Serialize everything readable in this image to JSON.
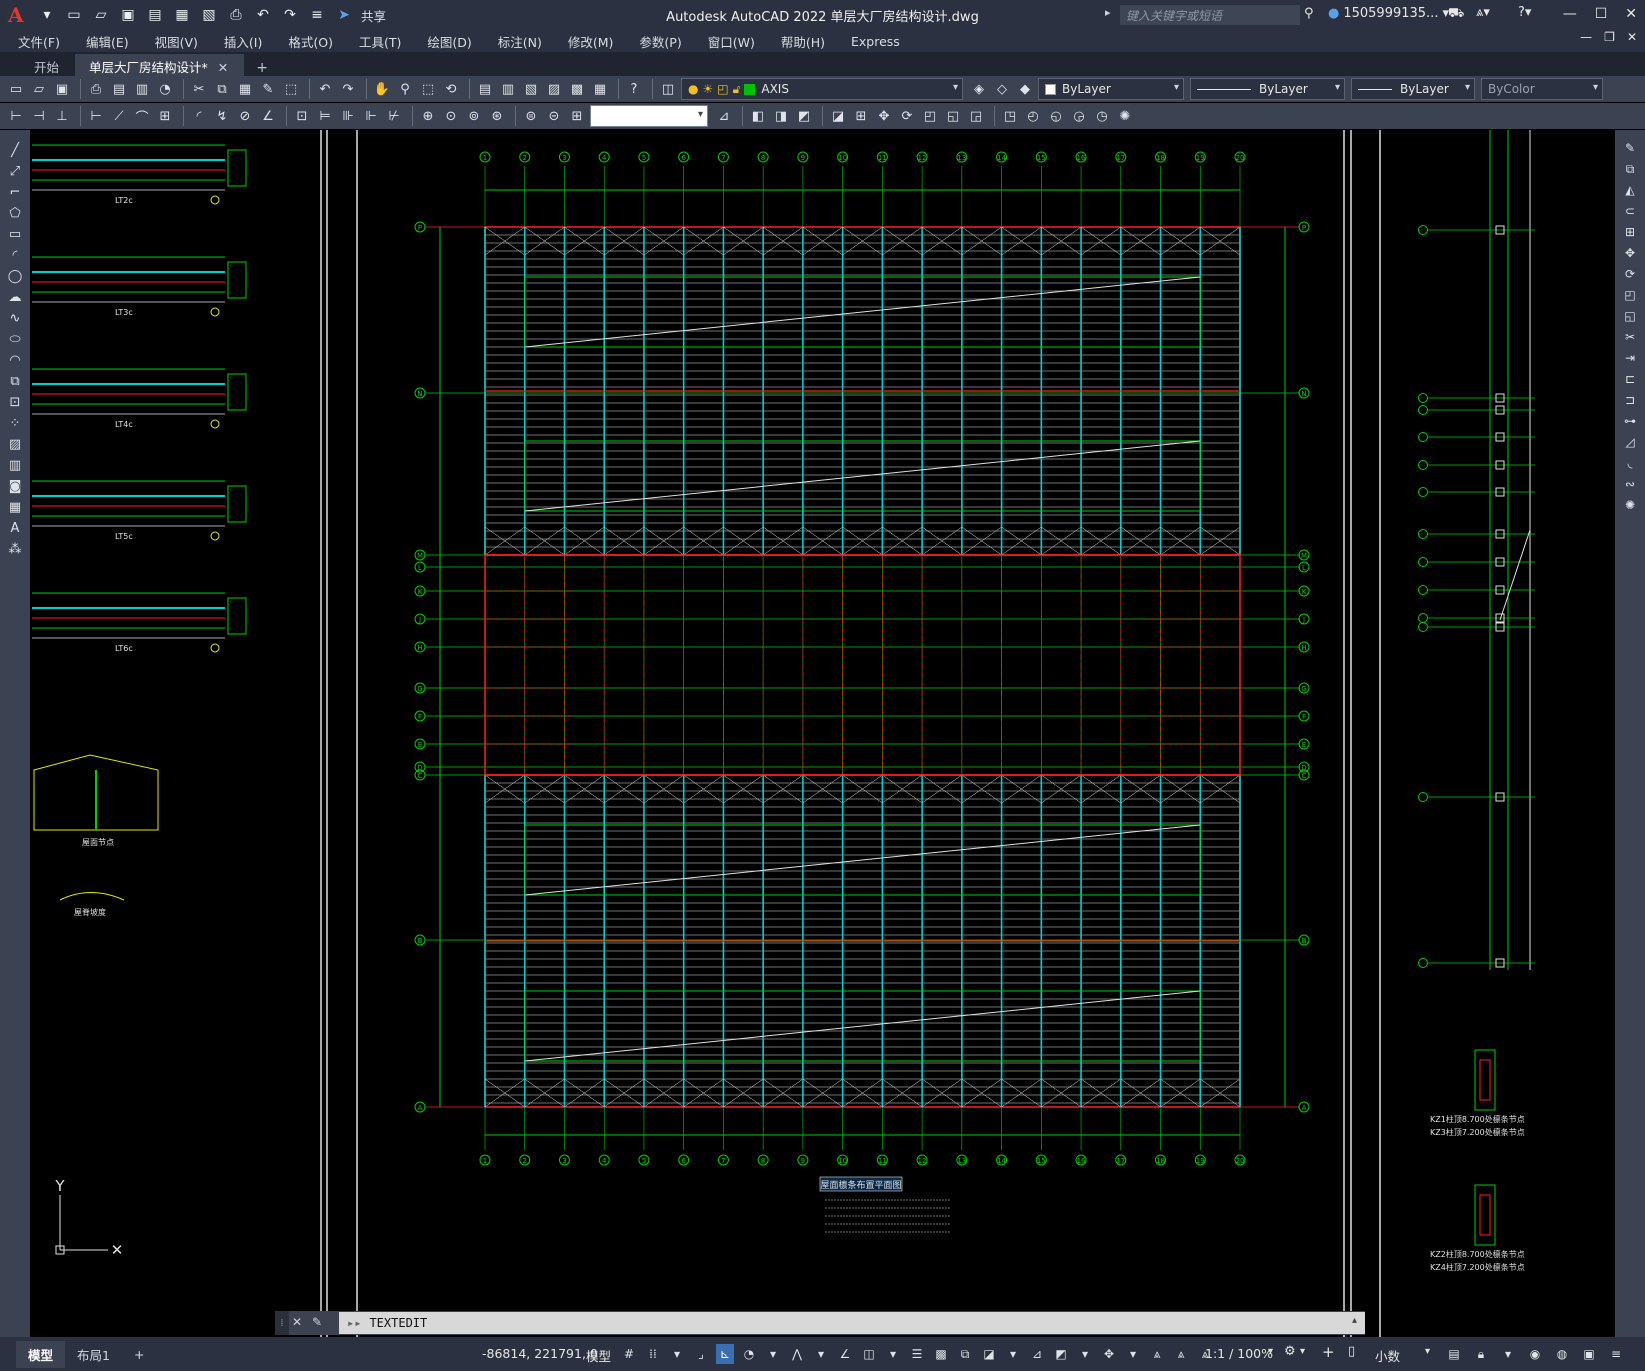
{
  "app": {
    "title": "Autodesk AutoCAD 2022    单层大厂房结构设计.dwg",
    "share_label": "共享",
    "search_placeholder": "键入关键字或短语",
    "user": "1505999135...",
    "accent": "#e8352b"
  },
  "menu": [
    "文件(F)",
    "编辑(E)",
    "视图(V)",
    "插入(I)",
    "格式(O)",
    "工具(T)",
    "绘图(D)",
    "标注(N)",
    "修改(M)",
    "参数(P)",
    "窗口(W)",
    "帮助(H)",
    "Express"
  ],
  "file_tabs": {
    "start": "开始",
    "active": "单层大厂房结构设计*"
  },
  "layer": {
    "name": "AXIS",
    "color_swatch": "#00c000"
  },
  "properties": {
    "color": "ByLayer",
    "linetype": "ByLayer",
    "lineweight": "ByLayer",
    "plotstyle": "ByColor"
  },
  "command_line": {
    "text": "TEXTEDIT"
  },
  "layout_tabs": [
    "模型",
    "布局1"
  ],
  "status": {
    "coordinates": "-86814, 221791, 0",
    "space": "模型",
    "scale": "1:1 / 100%",
    "units": "小数"
  },
  "drawing": {
    "left_details": [
      "LT2c",
      "LT3c",
      "LT4c",
      "LT5c",
      "LT6c"
    ],
    "node_labels": [
      "屋面节点",
      "屋脊坡度"
    ],
    "grid_cols": [
      "1",
      "2",
      "3",
      "4",
      "5",
      "6",
      "7",
      "8",
      "9",
      "10",
      "11",
      "12",
      "13",
      "14",
      "15",
      "16",
      "17",
      "18",
      "19",
      "20"
    ],
    "grid_rows": [
      "P",
      "N",
      "M",
      "L",
      "K",
      "J",
      "H",
      "G",
      "F",
      "E",
      "D",
      "C",
      "B",
      "A"
    ],
    "plan_title": "屋面檩条布置平面图",
    "column_details": [
      "KZ1柱顶8.700处檩条节点",
      "KZ3柱顶7.200处檩条节点",
      "KZ2柱顶8.700处檩条节点",
      "KZ4柱顶7.200处檩条节点"
    ],
    "ucs": {
      "y": "Y"
    }
  }
}
